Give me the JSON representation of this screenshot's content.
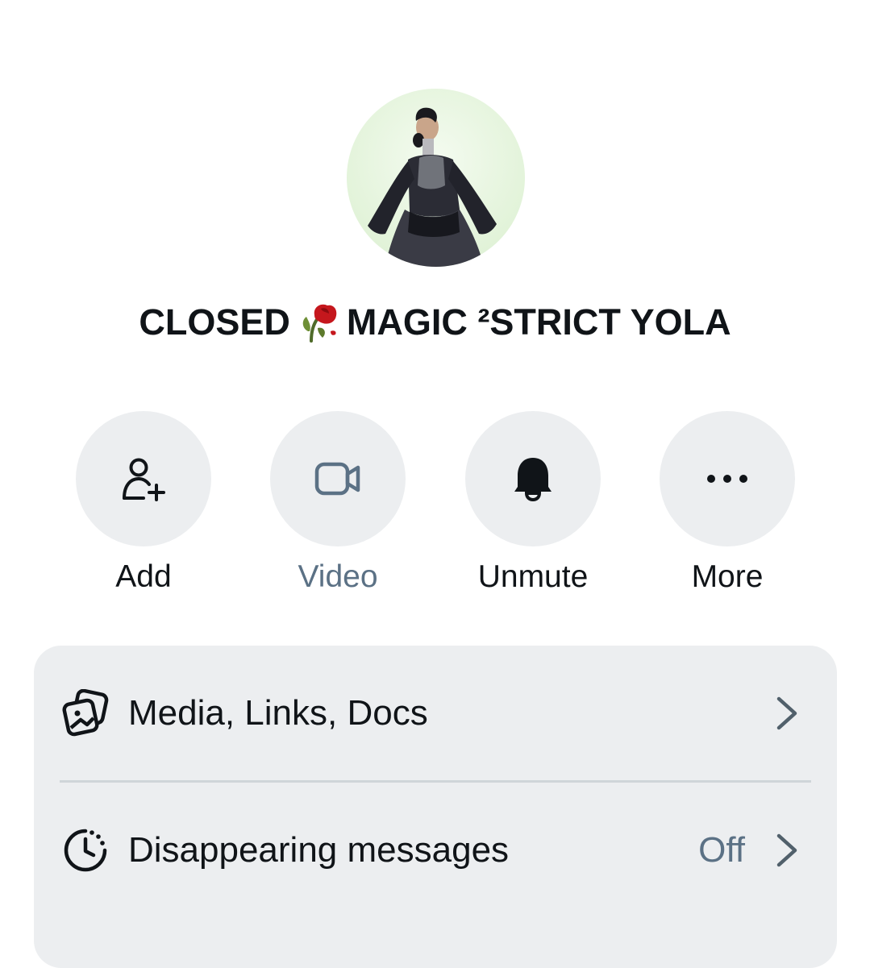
{
  "profile": {
    "display_name_before": "CLOSED",
    "display_name_emoji": "wilted-rose-emoji",
    "display_name_after": "MAGIC ²STRICT YOLA"
  },
  "actions": [
    {
      "label": "Add",
      "icon": "add-person-icon",
      "enabled": true
    },
    {
      "label": "Video",
      "icon": "video-camera-icon",
      "enabled": false
    },
    {
      "label": "Unmute",
      "icon": "bell-icon",
      "enabled": true
    },
    {
      "label": "More",
      "icon": "more-dots-icon",
      "enabled": true
    }
  ],
  "settings": {
    "media_links_docs": {
      "label": "Media, Links, Docs",
      "icon": "media-gallery-icon"
    },
    "disappearing_messages": {
      "label": "Disappearing messages",
      "value": "Off",
      "icon": "timer-icon"
    }
  },
  "colors": {
    "text": "#101418",
    "muted": "#5b7185",
    "surface": "#eceef0",
    "avatar_bg": "#e2f3d9"
  }
}
